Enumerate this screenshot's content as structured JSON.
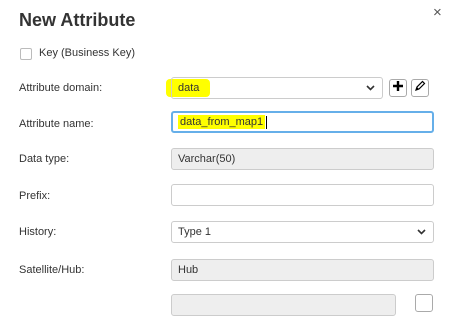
{
  "dialog": {
    "title": "New Attribute",
    "close_glyph": "×"
  },
  "form": {
    "key_checkbox_label": "Key (Business Key)",
    "key_checked": false,
    "attribute_domain": {
      "label": "Attribute domain:",
      "value": "data",
      "add_icon": "plus-icon",
      "edit_icon": "pencil-icon"
    },
    "attribute_name": {
      "label": "Attribute name:",
      "value": "data_from_map1"
    },
    "data_type": {
      "label": "Data type:",
      "value": "Varchar(50)"
    },
    "prefix": {
      "label": "Prefix:",
      "value": ""
    },
    "history": {
      "label": "History:",
      "value": "Type 1"
    },
    "satellite_hub": {
      "label": "Satellite/Hub:",
      "value": "Hub"
    }
  },
  "colors": {
    "highlight": "#ffff00",
    "focus_border": "#66afe9",
    "readonly_bg": "#eeeeee"
  }
}
